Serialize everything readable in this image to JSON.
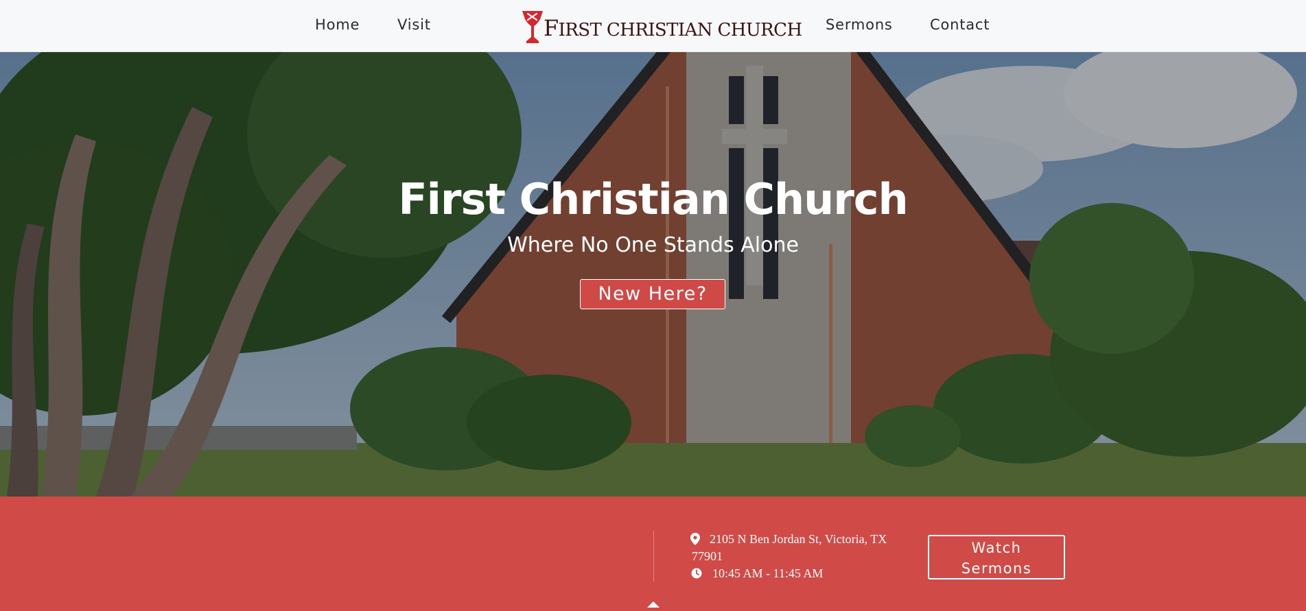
{
  "nav": {
    "links_left": [
      "Home",
      "Visit"
    ],
    "links_right": [
      "Sermons",
      "Contact"
    ],
    "logo": {
      "text_first": "F",
      "text_rest": "IRST CHRISTIAN CHURCH"
    }
  },
  "hero": {
    "title": "First Christian Church",
    "subtitle": "Where No One Stands Alone",
    "cta_label": "New Here?"
  },
  "info": {
    "address_line1": "2105 N Ben Jordan St, Victoria, TX",
    "address_line2": "77901",
    "hours": "10:45 AM - 11:45 AM",
    "watch_line1": "Watch",
    "watch_line2": "Sermons",
    "address_icon": "map-pin-icon",
    "hours_icon": "clock-icon"
  },
  "colors": {
    "accent_red": "#d04a47",
    "nav_bg": "#f7f8fa",
    "logo_red": "#d8262e",
    "logo_text": "#3a1410"
  }
}
